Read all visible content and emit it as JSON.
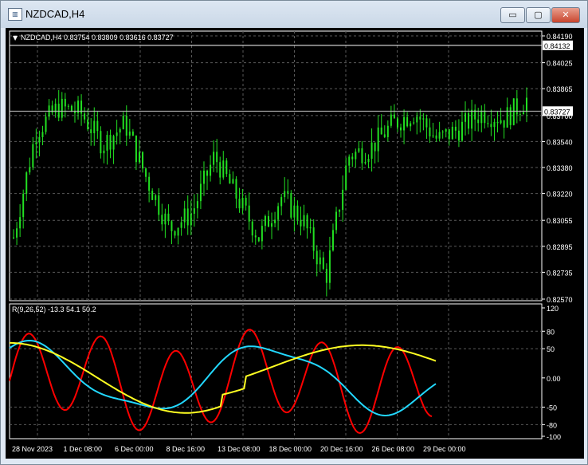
{
  "window": {
    "title": "NZDCAD,H4",
    "icon": "chart-icon",
    "buttons": {
      "minimize": "▭",
      "maximize": "▢",
      "close": "✕"
    }
  },
  "chart": {
    "header_arrow": "▼",
    "header": "NZDCAD,H4  0.83754 0.83809 0.83616 0.83727",
    "price_labels": [
      "0.84190",
      "0.84025",
      "0.83865",
      "0.83700",
      "0.83540",
      "0.83380",
      "0.83220",
      "0.83055",
      "0.82895",
      "0.82735",
      "0.82570"
    ],
    "price_lines": [
      {
        "label": "0.84132",
        "value": 0.84132,
        "color": "#ffffff"
      },
      {
        "label": "0.83727",
        "value": 0.83727,
        "color": "#c0c0c0"
      }
    ],
    "candle_color": "#22e022",
    "indicator": {
      "label": "R(9,26,52) -13.3 54.1 50.2",
      "ticks": [
        "120",
        "80",
        "50",
        "0.00",
        "-50",
        "-80",
        "-100"
      ],
      "tick_values": [
        120,
        80,
        50,
        0,
        -50,
        -80,
        -100
      ],
      "series_colors": {
        "fast": "#ff0000",
        "mid": "#22d8ff",
        "slow": "#ffff22"
      }
    },
    "time_labels": [
      "28 Nov 2023",
      "1 Dec 08:00",
      "6 Dec 00:00",
      "8 Dec 16:00",
      "13 Dec 08:00",
      "18 Dec 00:00",
      "20 Dec 16:00",
      "26 Dec 08:00",
      "29 Dec 00:00"
    ]
  }
}
